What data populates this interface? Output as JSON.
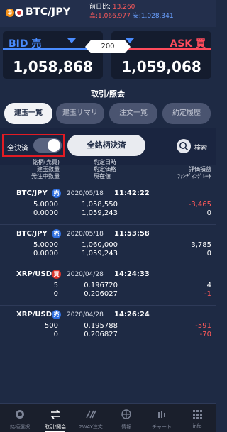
{
  "header": {
    "pair": "BTC/JPY",
    "btc_coin_glyph": "₿",
    "prev_day_label": "前日比:",
    "prev_day_value": "13,260",
    "high_label": "高:",
    "high_value": "1,066,977",
    "low_label": "安:",
    "low_value": "1,028,341"
  },
  "quote": {
    "bid_label": "BID 売",
    "bid_price": "1,058,868",
    "spread": "200",
    "ask_label": "ASK 買",
    "ask_price": "1,059,068"
  },
  "section_title": "取引/照会",
  "tabs": [
    {
      "label": "建玉一覧",
      "active": true
    },
    {
      "label": "建玉サマリ",
      "active": false
    },
    {
      "label": "注文一覧",
      "active": false
    },
    {
      "label": "約定履歴",
      "active": false
    }
  ],
  "controls": {
    "toggle_label": "全決済",
    "all_settle_button": "全銘柄決済",
    "search_label": "検索"
  },
  "columns": {
    "left": [
      "銘柄(売買)",
      "建玉数量",
      "発注中数量"
    ],
    "middle": [
      "約定日時",
      "約定価格",
      "現在値"
    ],
    "right": [
      "評価損益",
      "ﾌｧﾝﾃﾞｨﾝｸﾞﾚｰﾄ"
    ]
  },
  "positions": [
    {
      "symbol": "BTC/JPY",
      "side": "売",
      "side_type": "sell",
      "date": "2020/05/18",
      "time": "11:42:22",
      "qty": "5.0000",
      "pending": "0.0000",
      "exec_price": "1,058,550",
      "current": "1,059,243",
      "pl": "-3,465",
      "funding": "0",
      "pl_sign": "neg",
      "funding_sign": "pos"
    },
    {
      "symbol": "BTC/JPY",
      "side": "売",
      "side_type": "sell",
      "date": "2020/05/18",
      "time": "11:53:58",
      "qty": "5.0000",
      "pending": "0.0000",
      "exec_price": "1,060,000",
      "current": "1,059,243",
      "pl": "3,785",
      "funding": "0",
      "pl_sign": "pos",
      "funding_sign": "pos"
    },
    {
      "symbol": "XRP/USD",
      "side": "買",
      "side_type": "buy",
      "date": "2020/04/28",
      "time": "14:24:33",
      "qty": "5",
      "pending": "0",
      "exec_price": "0.196720",
      "current": "0.206027",
      "pl": "4",
      "funding": "-1",
      "pl_sign": "pos",
      "funding_sign": "neg"
    },
    {
      "symbol": "XRP/USD",
      "side": "売",
      "side_type": "sell",
      "date": "2020/04/28",
      "time": "14:26:24",
      "qty": "500",
      "pending": "0",
      "exec_price": "0.195788",
      "current": "0.206827",
      "pl": "-591",
      "funding": "-70",
      "pl_sign": "neg",
      "funding_sign": "neg"
    }
  ],
  "nav": [
    {
      "label": "銘柄選択",
      "icon": "symbol-select-icon",
      "active": false
    },
    {
      "label": "取引/照会",
      "icon": "trade-inquiry-icon",
      "active": true
    },
    {
      "label": "2WAY注文",
      "icon": "two-way-order-icon",
      "active": false
    },
    {
      "label": "情報",
      "icon": "info-globe-icon",
      "active": false
    },
    {
      "label": "チャート",
      "icon": "chart-icon",
      "active": false
    },
    {
      "label": "info",
      "icon": "grid-icon",
      "active": false
    }
  ]
}
